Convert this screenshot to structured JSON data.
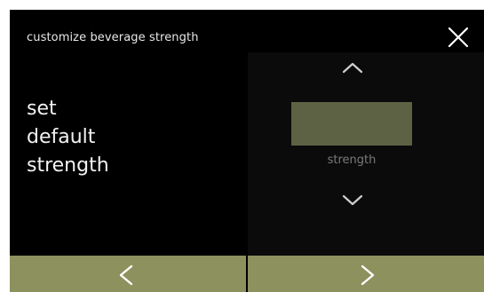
{
  "header": {
    "title": "customize beverage strength"
  },
  "left": {
    "lines": [
      "set",
      "default",
      "strength"
    ]
  },
  "strength_selector": {
    "label": "strength",
    "value": ""
  },
  "icons": {
    "close": "close-icon",
    "up": "chevron-up-icon",
    "down": "chevron-down-icon",
    "prev": "chevron-left-icon",
    "next": "chevron-right-icon"
  },
  "colors": {
    "background": "#000000",
    "value_box": "#5e6244",
    "footer_button": "#8c915e",
    "label_gray": "#7a7a7a"
  }
}
